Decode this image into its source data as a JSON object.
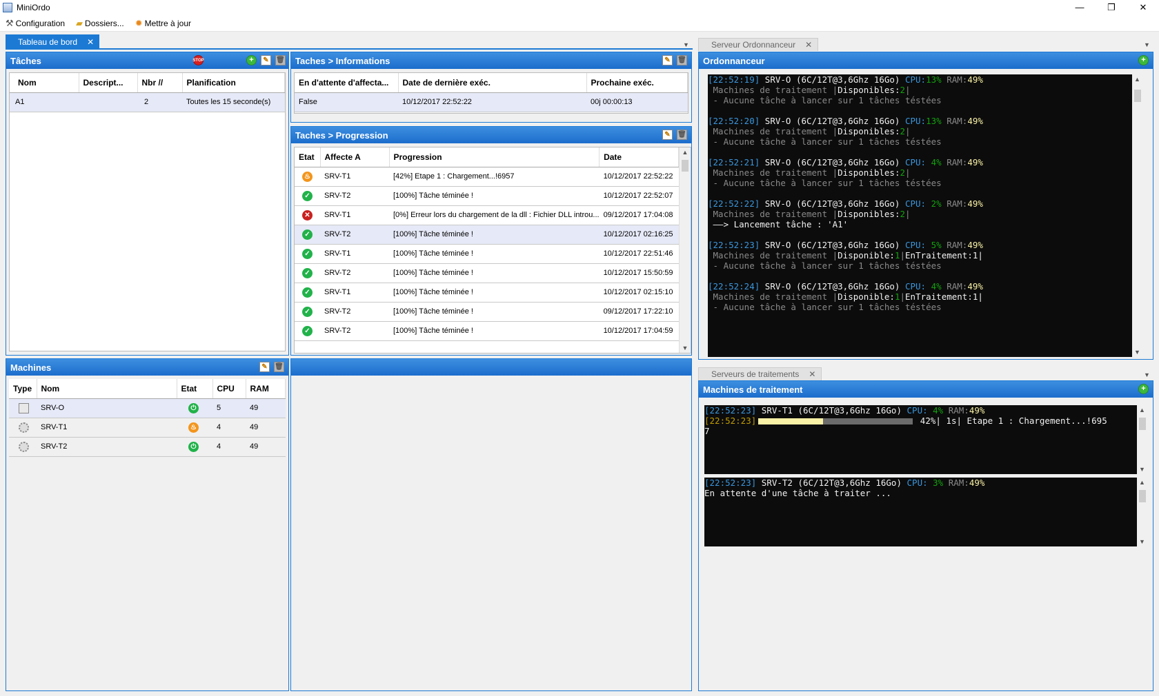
{
  "window": {
    "title": "MiniOrdo",
    "minimize": "—",
    "restore": "❐",
    "close": "✕"
  },
  "menu": [
    {
      "label": "Configuration",
      "icon": "tools-icon"
    },
    {
      "label": "Dossiers...",
      "icon": "folder-icon"
    },
    {
      "label": "Mettre à jour",
      "icon": "update-gear-icon"
    }
  ],
  "tabs": {
    "main": "Tableau de bord",
    "scheduler": "Serveur Ordonnanceur",
    "workers": "Serveurs de traitements"
  },
  "taches": {
    "title": "Tâches",
    "columns": [
      "Nom",
      "Descript...",
      "Nbr //",
      "Planification"
    ],
    "rows": [
      [
        "A1",
        "",
        "2",
        "Toutes les 15 seconde(s)"
      ]
    ]
  },
  "informations": {
    "title": "Taches > Informations",
    "columns": [
      "En d'attente d'affecta...",
      "Date de dernière exéc.",
      "Prochaine exéc."
    ],
    "rows": [
      [
        "False",
        "10/12/2017 22:52:22",
        "00j 00:00:13"
      ]
    ]
  },
  "progression": {
    "title": "Taches > Progression",
    "columns": [
      "Etat",
      "Affecte A",
      "Progression",
      "Date"
    ],
    "rows": [
      {
        "state": "running",
        "server": "SRV-T1",
        "progress": "[42%] Etape 1 : Chargement...!6957",
        "date": "10/12/2017 22:52:22"
      },
      {
        "state": "ok",
        "server": "SRV-T2",
        "progress": "[100%] Tâche téminée !",
        "date": "10/12/2017 22:52:07"
      },
      {
        "state": "error",
        "server": "SRV-T1",
        "progress": "[0%] Erreur lors du chargement de la dll : Fichier DLL introu...",
        "date": "09/12/2017 17:04:08"
      },
      {
        "state": "ok",
        "server": "SRV-T2",
        "progress": "[100%] Tâche téminée !",
        "date": "10/12/2017 02:16:25"
      },
      {
        "state": "ok",
        "server": "SRV-T1",
        "progress": "[100%] Tâche téminée !",
        "date": "10/12/2017 22:51:46"
      },
      {
        "state": "ok",
        "server": "SRV-T2",
        "progress": "[100%] Tâche téminée !",
        "date": "10/12/2017 15:50:59"
      },
      {
        "state": "ok",
        "server": "SRV-T1",
        "progress": "[100%] Tâche téminée !",
        "date": "10/12/2017 02:15:10"
      },
      {
        "state": "ok",
        "server": "SRV-T2",
        "progress": "[100%] Tâche téminée !",
        "date": "09/12/2017 17:22:10"
      },
      {
        "state": "ok",
        "server": "SRV-T2",
        "progress": "[100%] Tâche téminée !",
        "date": "10/12/2017 17:04:59"
      }
    ]
  },
  "machines": {
    "title": "Machines",
    "columns": [
      "Type",
      "Nom",
      "Etat",
      "CPU",
      "RAM"
    ],
    "rows": [
      {
        "type": "server",
        "name": "SRV-O",
        "state": "on",
        "cpu": "5",
        "ram": "49"
      },
      {
        "type": "worker",
        "name": "SRV-T1",
        "state": "busy",
        "cpu": "4",
        "ram": "49"
      },
      {
        "type": "worker",
        "name": "SRV-T2",
        "state": "on",
        "cpu": "4",
        "ram": "49"
      }
    ]
  },
  "ordonnanceur": {
    "title": "Ordonnanceur",
    "blocks": [
      {
        "ts": "[22:52:19]",
        "srv": " SRV-O (6C/12T@3,6Ghz 16Go) ",
        "cpu_label": "CPU:",
        "cpu": "13%",
        "ram_label": " RAM:",
        "ram": "49%",
        "line2a": " Machines de traitement |",
        "line2b": "Disponibles:",
        "line2c": "2",
        "line2d": "|",
        "line2e": "",
        "line3": " - Aucune tâche à lancer sur 1 tâches téstées"
      },
      {
        "ts": "[22:52:20]",
        "srv": " SRV-O (6C/12T@3,6Ghz 16Go) ",
        "cpu_label": "CPU:",
        "cpu": "13%",
        "ram_label": " RAM:",
        "ram": "49%",
        "line2a": " Machines de traitement |",
        "line2b": "Disponibles:",
        "line2c": "2",
        "line2d": "|",
        "line2e": "",
        "line3": " - Aucune tâche à lancer sur 1 tâches téstées"
      },
      {
        "ts": "[22:52:21]",
        "srv": " SRV-O (6C/12T@3,6Ghz 16Go) ",
        "cpu_label": "CPU:",
        "cpu": " 4%",
        "ram_label": " RAM:",
        "ram": "49%",
        "line2a": " Machines de traitement |",
        "line2b": "Disponibles:",
        "line2c": "2",
        "line2d": "|",
        "line2e": "",
        "line3": " - Aucune tâche à lancer sur 1 tâches téstées"
      },
      {
        "ts": "[22:52:22]",
        "srv": " SRV-O (6C/12T@3,6Ghz 16Go) ",
        "cpu_label": "CPU:",
        "cpu": " 2%",
        "ram_label": " RAM:",
        "ram": "49%",
        "line2a": " Machines de traitement |",
        "line2b": "Disponibles:",
        "line2c": "2",
        "line2d": "|",
        "line2e": "",
        "line3": " ——> Lancement tâche : 'A1'"
      },
      {
        "ts": "[22:52:23]",
        "srv": " SRV-O (6C/12T@3,6Ghz 16Go) ",
        "cpu_label": "CPU:",
        "cpu": " 5%",
        "ram_label": " RAM:",
        "ram": "49%",
        "line2a": " Machines de traitement |",
        "line2b": "Disponible:",
        "line2c": "1",
        "line2d": "|",
        "line2e": "EnTraitement:1|",
        "line3": " - Aucune tâche à lancer sur 1 tâches téstées"
      },
      {
        "ts": "[22:52:24]",
        "srv": " SRV-O (6C/12T@3,6Ghz 16Go) ",
        "cpu_label": "CPU:",
        "cpu": " 4%",
        "ram_label": " RAM:",
        "ram": "49%",
        "line2a": " Machines de traitement |",
        "line2b": "Disponible:",
        "line2c": "1",
        "line2d": "|",
        "line2e": "EnTraitement:1|",
        "line3": " - Aucune tâche à lancer sur 1 tâches téstées"
      }
    ]
  },
  "traitement": {
    "title": "Machines de traitement",
    "t1": {
      "ts": "[22:52:23]",
      "srv": " SRV-T1 (6C/12T@3,6Ghz 16Go) ",
      "cpu_label": "CPU:",
      "cpu": " 4%",
      "ram_label": " RAM:",
      "ram": "49%",
      "ts2": "[22:52:23]",
      "progress": 0.42,
      "pct": " 42%|",
      "elapsed": " 1s|",
      "step": " Etape 1 : Chargement...!695",
      "wrap": "7"
    },
    "t2": {
      "ts": "[22:52:23]",
      "srv": " SRV-T2 (6C/12T@3,6Ghz 16Go) ",
      "cpu_label": "CPU:",
      "cpu": " 3%",
      "ram_label": " RAM:",
      "ram": "49%",
      "line2": "En attente d'une tâche à traiter ..."
    }
  },
  "colors": {
    "accent": "#1c7ad4",
    "ok": "#21b24a",
    "error": "#c8211f",
    "running": "#f3951c"
  }
}
